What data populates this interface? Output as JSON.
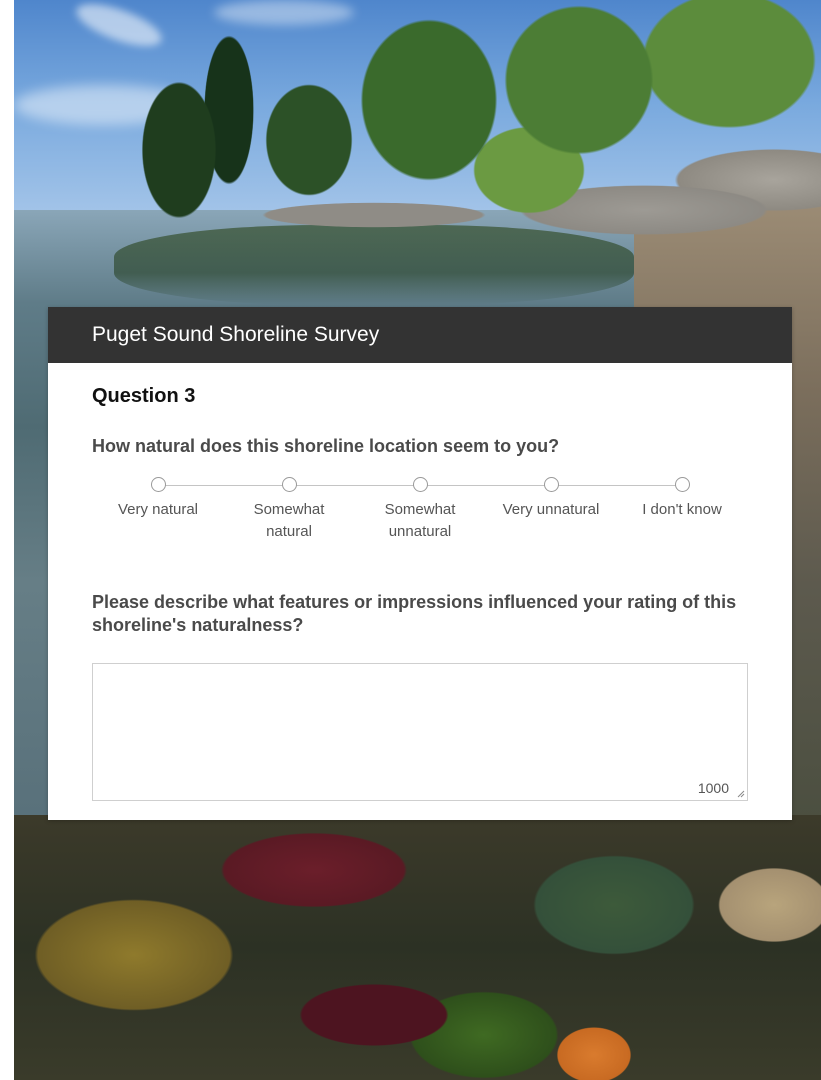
{
  "survey": {
    "title": "Puget Sound Shoreline Survey",
    "question_number": "Question 3",
    "question_prompt": "How natural does this shoreline location seem to you?",
    "scale_options": [
      {
        "label": "Very natural",
        "selected": false
      },
      {
        "label": "Somewhat natural",
        "selected": false
      },
      {
        "label": "Somewhat unnatural",
        "selected": false
      },
      {
        "label": "Very unnatural",
        "selected": false
      },
      {
        "label": "I don't know",
        "selected": false
      }
    ],
    "followup_prompt": "Please describe what features or impressions influenced your rating of this shoreline's naturalness?",
    "textarea_value": "",
    "char_limit": "1000"
  },
  "colors": {
    "header_bg": "#333333",
    "header_text": "#ffffff",
    "radio_border": "#9a9a9a"
  },
  "icons": {
    "resize": "resize-grip-icon"
  }
}
